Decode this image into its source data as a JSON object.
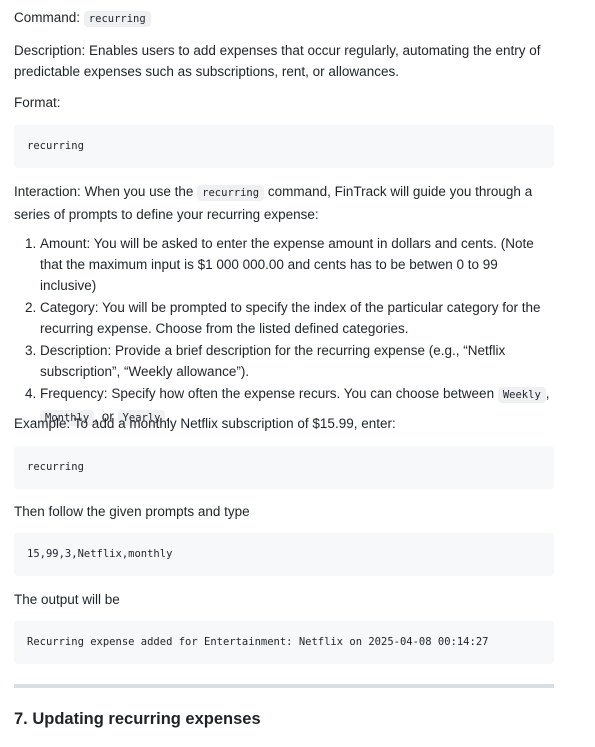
{
  "command": {
    "label": "Command:",
    "value": "recurring"
  },
  "description": {
    "label": "Description:",
    "text": "Enables users to add expenses that occur regularly, automating the entry of predictable expenses such as subscriptions, rent, or allowances."
  },
  "format": {
    "label": "Format:",
    "code": "recurring"
  },
  "interaction": {
    "label": "Interaction:",
    "before": "When you use the",
    "code": "recurring",
    "after": "command, FinTrack will guide you through a series of prompts to define your recurring expense:"
  },
  "steps": [
    {
      "label": "Amount:",
      "text": "You will be asked to enter the expense amount in dollars and cents. (Note that the maximum input is $1 000 000.00 and cents has to be betwen 0 to 99 inclusive)"
    },
    {
      "label": "Category:",
      "text": "You will be prompted to specify the index of the particular category for the recurring expense. Choose from the listed defined categories."
    },
    {
      "label": "Description:",
      "text": "Provide a brief description for the recurring expense (e.g., “Netflix subscription”, “Weekly allowance”)."
    },
    {
      "label": "Frequency:",
      "text": "Specify how often the expense recurs. You can choose between",
      "opt1": "Weekly",
      "sep1": ",",
      "opt2": "Monthly",
      "sep2": ", or",
      "opt3": "Yearly",
      "end": "."
    }
  ],
  "example": {
    "label": "Example:",
    "text": "To add a monthly Netflix subscription of $15.99, enter:",
    "code": "recurring"
  },
  "followup": {
    "text": "Then follow the given prompts and type",
    "code": "15,99,3,Netflix,monthly"
  },
  "output": {
    "text": "The output will be",
    "code": "Recurring expense added for Entertainment: Netflix on 2025-04-08 00:14:27"
  },
  "next_section": {
    "title": "7. Updating recurring expenses"
  }
}
